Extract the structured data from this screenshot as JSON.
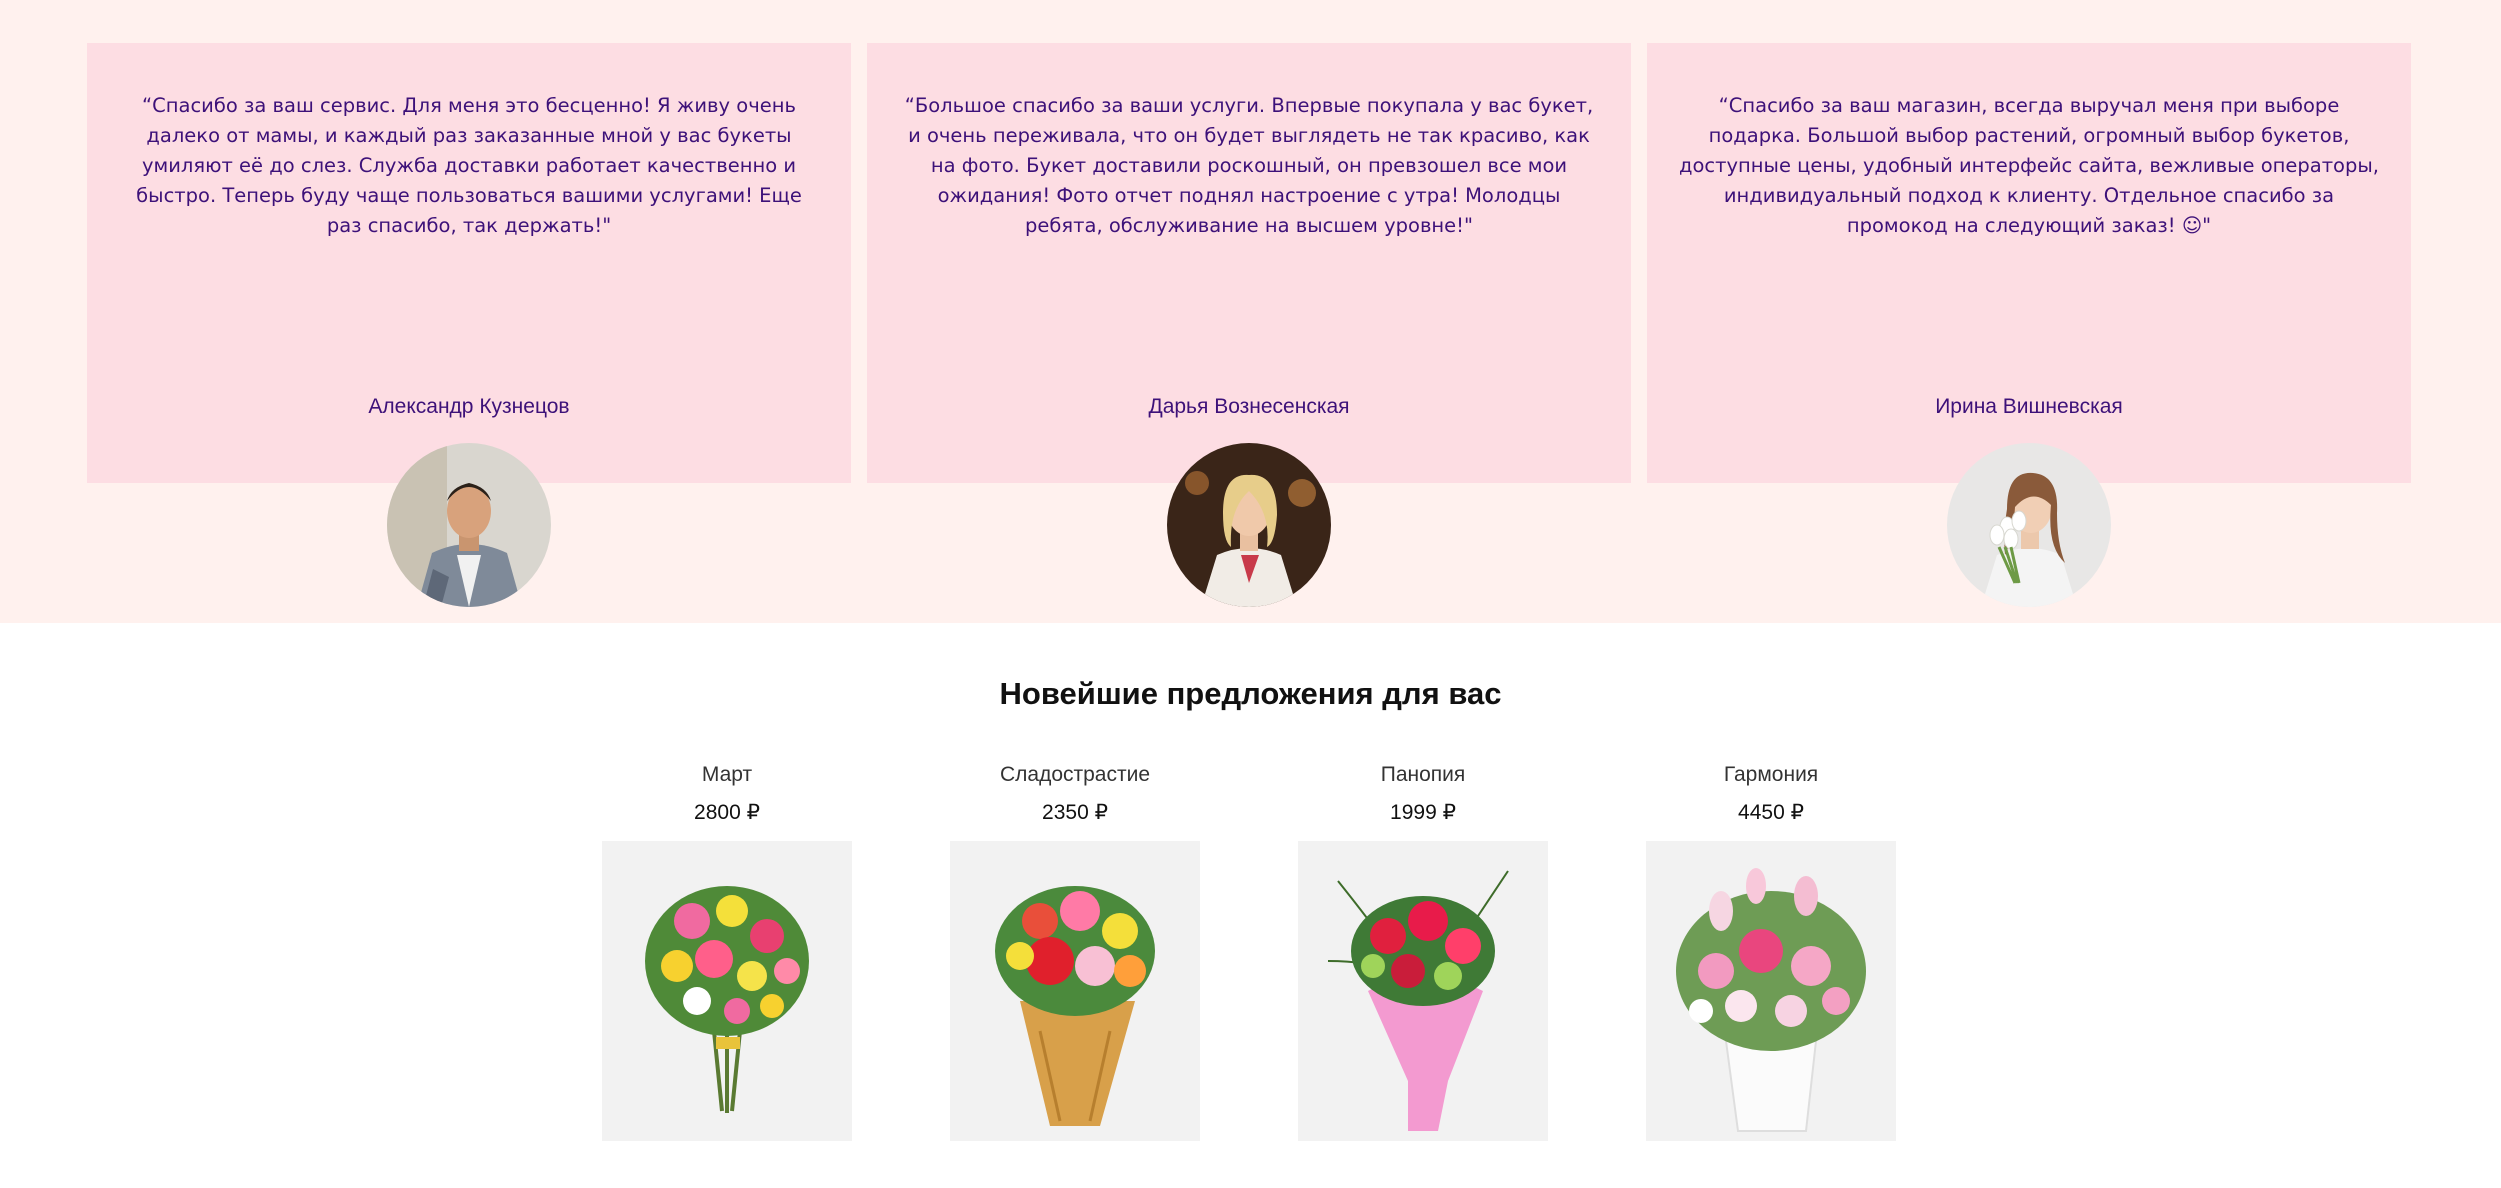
{
  "reviews": [
    {
      "text": "“Спасибо за ваш сервис. Для меня это бесценно! Я живу очень далеко от мамы, и каждый раз заказанные мной у вас букеты умиляют её до слез. Служба доставки работает качественно и быстро. Теперь буду чаще пользоваться вашими услугами! Еще раз спасибо, так держать!\"",
      "author": "Александр Кузнецов"
    },
    {
      "text": "“Большое спасибо за ваши услуги. Впервые покупала у вас букет, и очень переживала, что он будет выглядеть не так красиво, как на фото. Букет доставили роскошный, он превзошел все мои ожидания! Фото отчет поднял настроение с утра! Молодцы ребята, обслуживание на высшем уровне!\"",
      "author": "Дарья Вознесенская"
    },
    {
      "text": "“Спасибо за ваш магазин, всегда выручал меня при выборе подарка. Большой выбор растений, огромный выбор букетов, доступные цены, удобный интерфейс сайта, вежливые операторы, индивидуальный подход к клиенту. Отдельное спасибо за промокод на следующий заказ! ☺\"",
      "author": "Ирина Вишневская"
    }
  ],
  "offers": {
    "title": "Новейшие предложения для вас",
    "products": [
      {
        "name": "Март",
        "price": "2800 ₽"
      },
      {
        "name": "Сладострастие",
        "price": "2350 ₽"
      },
      {
        "name": "Панопия",
        "price": "1999 ₽"
      },
      {
        "name": "Гармония",
        "price": "4450 ₽"
      }
    ]
  },
  "colors": {
    "reviews_bg": "#fff1ee",
    "card_bg": "#fddde3",
    "review_text": "#3d1179"
  }
}
